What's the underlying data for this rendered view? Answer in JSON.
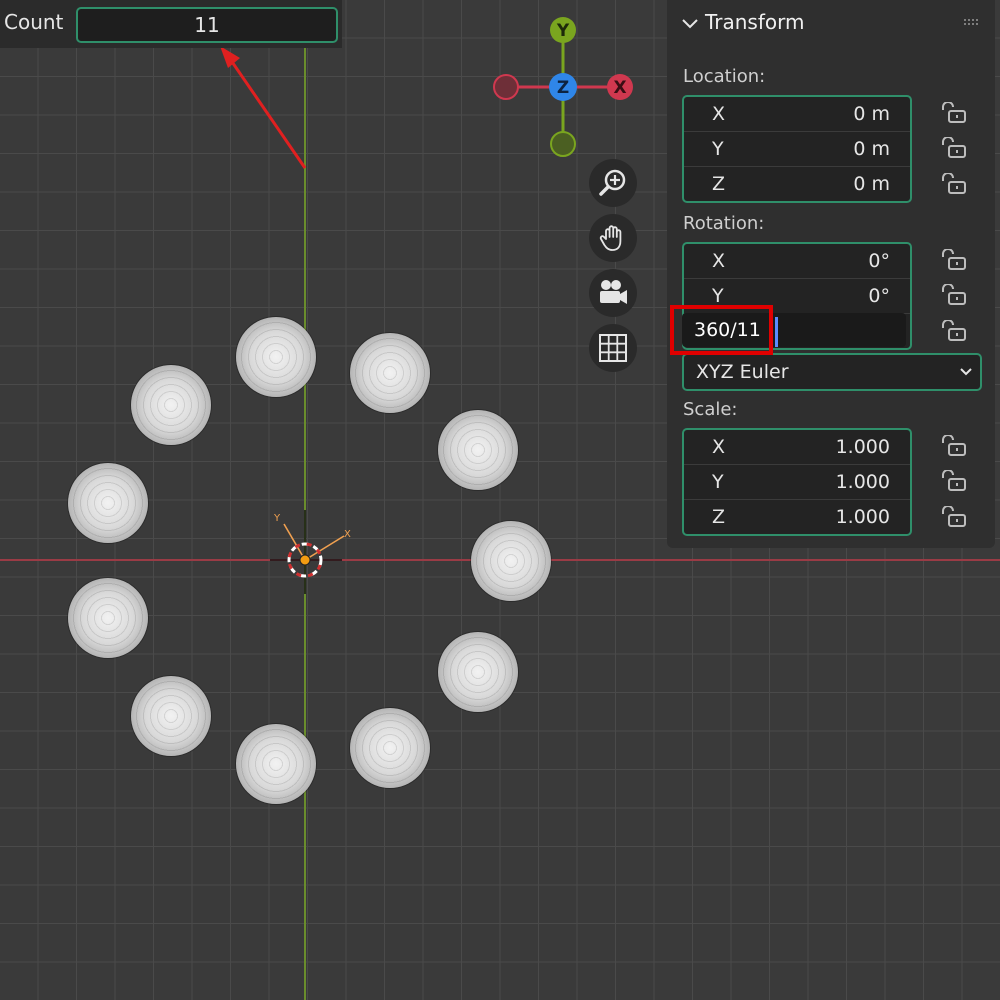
{
  "operator": {
    "count_label": "Count",
    "count_value": "11"
  },
  "gizmo": {
    "y_label": "Y",
    "z_label": "Z",
    "x_label": "X"
  },
  "origin": {
    "y_label": "Y",
    "x_label": "X"
  },
  "nav": {
    "icons": [
      "zoom-icon",
      "hand-pan-icon",
      "camera-icon",
      "grid-icon"
    ]
  },
  "panel": {
    "title": "Transform",
    "location_label": "Location:",
    "location": [
      {
        "axis": "X",
        "value": "0 m"
      },
      {
        "axis": "Y",
        "value": "0 m"
      },
      {
        "axis": "Z",
        "value": "0 m"
      }
    ],
    "rotation_label": "Rotation:",
    "rotation": [
      {
        "axis": "X",
        "value": "0°"
      },
      {
        "axis": "Y",
        "value": "0°"
      }
    ],
    "rotation_z_edit": "360/11",
    "rotation_mode": "XYZ Euler",
    "scale_label": "Scale:",
    "scale": [
      {
        "axis": "X",
        "value": "1.000"
      },
      {
        "axis": "Y",
        "value": "1.000"
      },
      {
        "axis": "Z",
        "value": "1.000"
      }
    ]
  },
  "colors": {
    "accent": "#2f8f6a",
    "x_axis": "#d0384f",
    "y_axis": "#7aa51f",
    "z_axis": "#2f86e8",
    "highlight": "#e00000"
  }
}
